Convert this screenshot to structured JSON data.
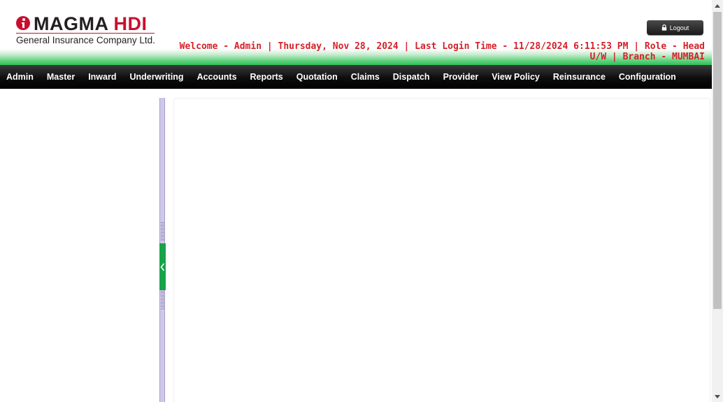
{
  "brand": {
    "name_part1": "MAGMA",
    "name_part2": "HDI",
    "subtitle": "General Insurance Company Ltd.",
    "accent_color": "#c8102e"
  },
  "header": {
    "logout_label": "Logout",
    "welcome_text": "Welcome - Admin | Thursday, Nov 28, 2024 | Last Login Time - 11/28/2024 6:11:53 PM | Role - Head U/W | Branch - MUMBAI",
    "welcome_color": "#d42128",
    "icons": [
      "lock-icon"
    ]
  },
  "nav": {
    "items": [
      "Admin",
      "Master",
      "Inward",
      "Underwriting",
      "Accounts",
      "Reports",
      "Quotation",
      "Claims",
      "Dispatch",
      "Provider",
      "View Policy",
      "Reinsurance",
      "Configuration"
    ]
  },
  "layout_colors": {
    "nav_background": "#000000",
    "header_band": "#2fbf58",
    "splitter": "#cfc8e8",
    "collapse_button": "#16a34a"
  },
  "icons": {
    "collapse": "chevron-left-icon",
    "scroll_up": "scroll-up-arrow-icon",
    "scroll_down": "scroll-down-arrow-icon"
  }
}
